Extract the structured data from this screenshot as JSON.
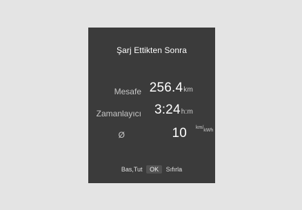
{
  "display": {
    "title": "Şarj Ettikten Sonra",
    "rows": [
      {
        "label": "Mesafe",
        "value": "256.4",
        "unit": "km"
      },
      {
        "label": "Zamanlayıcı",
        "value": "3:24",
        "unit": "h:m"
      },
      {
        "label": "Ø",
        "value": "10",
        "unit_top": "km/",
        "unit_bottom": "kWh"
      }
    ],
    "footer": {
      "press_hold": "Bas,Tut",
      "ok_key": "OK",
      "reset": "Sıfırla"
    }
  },
  "colors": {
    "background": "#e4e4e4",
    "panel": "#3b3b3b",
    "text": "#ffffff"
  }
}
